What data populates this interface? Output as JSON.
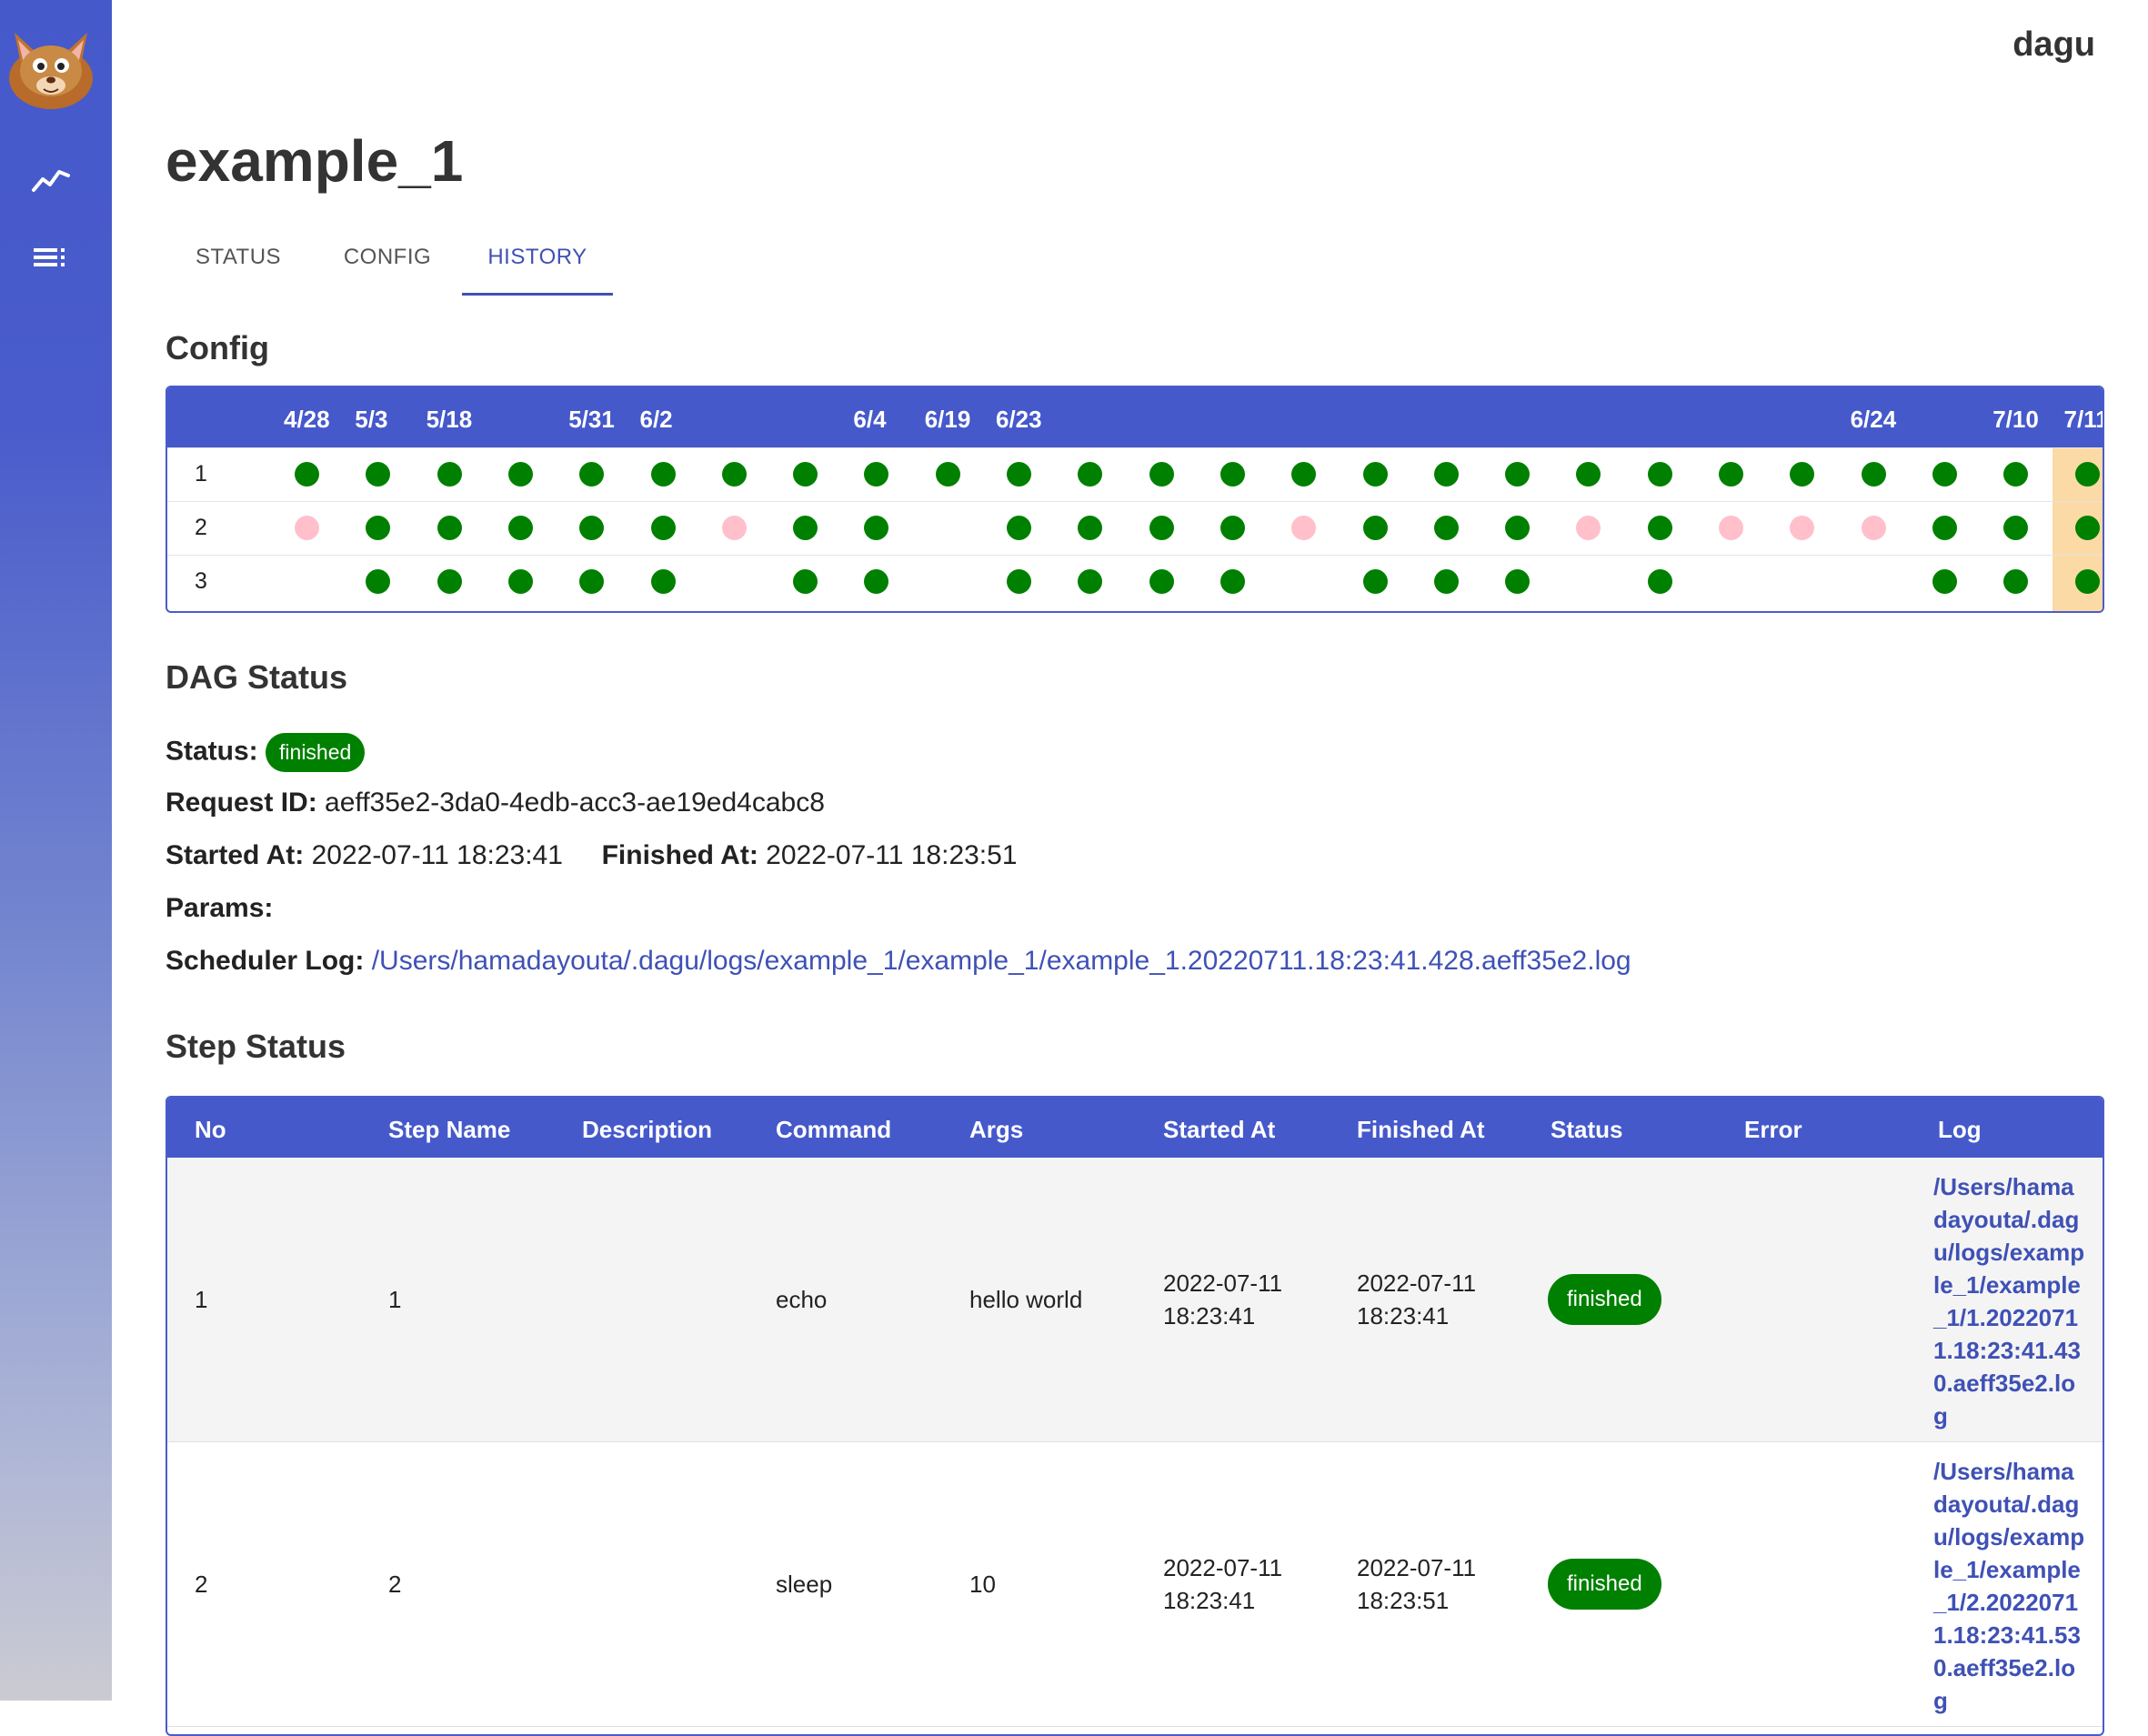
{
  "app": {
    "brand": "dagu"
  },
  "page": {
    "title": "example_1"
  },
  "tabs": [
    {
      "label": "STATUS",
      "active": false
    },
    {
      "label": "CONFIG",
      "active": false
    },
    {
      "label": "HISTORY",
      "active": true
    }
  ],
  "history": {
    "section_title": "Config",
    "dates": [
      "4/28",
      "5/3",
      "5/18",
      "5/31",
      "6/2",
      "6/4",
      "6/19",
      "6/23",
      "6/24",
      "7/10",
      "7/11"
    ],
    "rows": [
      {
        "label": "1",
        "cells": [
          "ok",
          "ok",
          "ok",
          "ok",
          "ok",
          "ok",
          "ok",
          "ok",
          "ok",
          "ok",
          "ok",
          "ok",
          "ok",
          "ok",
          "ok",
          "ok",
          "ok",
          "ok",
          "ok",
          "ok",
          "ok",
          "ok",
          "ok",
          "ok",
          "ok",
          "ok"
        ]
      },
      {
        "label": "2",
        "cells": [
          "err",
          "ok",
          "ok",
          "ok",
          "ok",
          "ok",
          "err",
          "ok",
          "ok",
          "",
          "ok",
          "ok",
          "ok",
          "ok",
          "err",
          "ok",
          "ok",
          "ok",
          "err",
          "ok",
          "err",
          "err",
          "err",
          "ok",
          "ok",
          "ok"
        ]
      },
      {
        "label": "3",
        "cells": [
          "",
          "ok",
          "ok",
          "ok",
          "ok",
          "ok",
          "",
          "ok",
          "ok",
          "",
          "ok",
          "ok",
          "ok",
          "ok",
          "",
          "ok",
          "ok",
          "ok",
          "",
          "ok",
          "",
          "",
          "",
          "ok",
          "ok",
          "ok"
        ]
      }
    ],
    "selected_column": 25
  },
  "dag_status": {
    "section_title": "DAG Status",
    "status_label": "Status:",
    "status_value": "finished",
    "request_id_label": "Request ID:",
    "request_id": "aeff35e2-3da0-4edb-acc3-ae19ed4cabc8",
    "started_label": "Started At:",
    "started_at": "2022-07-11 18:23:41",
    "finished_label": "Finished At:",
    "finished_at": "2022-07-11 18:23:51",
    "params_label": "Params:",
    "params": "",
    "scheduler_log_label": "Scheduler Log:",
    "scheduler_log": "/Users/hamadayouta/.dagu/logs/example_1/example_1/example_1.20220711.18:23:41.428.aeff35e2.log"
  },
  "step_status": {
    "section_title": "Step Status",
    "columns": [
      "No",
      "Step Name",
      "Description",
      "Command",
      "Args",
      "Started At",
      "Finished At",
      "Status",
      "Error",
      "Log"
    ],
    "rows": [
      {
        "no": "1",
        "name": "1",
        "description": "",
        "command": "echo",
        "args": "hello world",
        "started_date": "2022-07-11",
        "started_time": "18:23:41",
        "finished_date": "2022-07-11",
        "finished_time": "18:23:41",
        "status": "finished",
        "error": "",
        "log": "/Users/hamadayouta/.dagu/logs/example_1/example_1/1.20220711.18:23:41.430.aeff35e2.log"
      },
      {
        "no": "2",
        "name": "2",
        "description": "",
        "command": "sleep",
        "args": "10",
        "started_date": "2022-07-11",
        "started_time": "18:23:41",
        "finished_date": "2022-07-11",
        "finished_time": "18:23:51",
        "status": "finished",
        "error": "",
        "log": "/Users/hamadayouta/.dagu/logs/example_1/example_1/2.20220711.18:23:41.530.aeff35e2.log"
      }
    ]
  },
  "colors": {
    "primary": "#4559cb",
    "success": "#008000",
    "error": "#ffc0cb",
    "selected": "#fcdaa6",
    "link": "#3f51b5"
  },
  "icons": [
    "dagu-logo-icon",
    "chart-icon",
    "list-icon"
  ]
}
